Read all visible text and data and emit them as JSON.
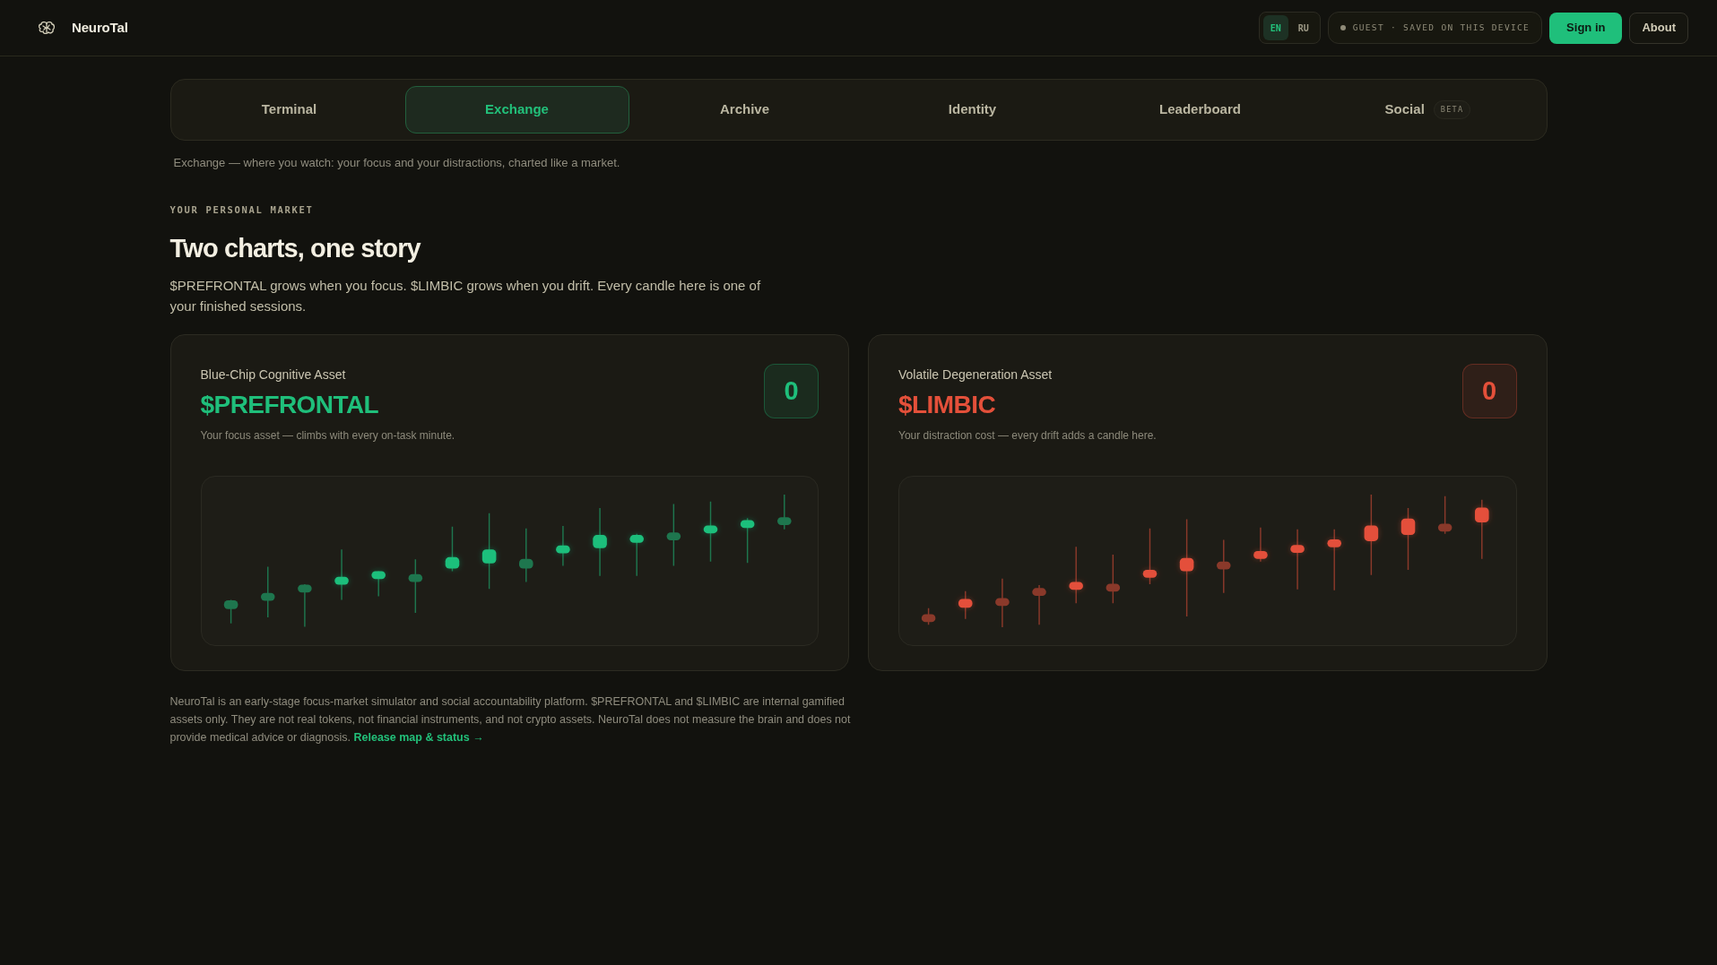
{
  "header": {
    "brand": "NeuroTal",
    "languages": [
      {
        "label": "EN",
        "selected": true
      },
      {
        "label": "RU",
        "selected": false
      }
    ],
    "status": "GUEST · SAVED ON THIS DEVICE",
    "buttons": [
      {
        "label": "Sign in",
        "kind": "primary"
      },
      {
        "label": "About",
        "kind": "secondary"
      }
    ]
  },
  "tabs": [
    {
      "label": "Terminal",
      "selected": false
    },
    {
      "label": "Exchange",
      "selected": true
    },
    {
      "label": "Archive",
      "selected": false
    },
    {
      "label": "Identity",
      "selected": false
    },
    {
      "label": "Leaderboard",
      "selected": false
    },
    {
      "label": "Social",
      "selected": false,
      "badge": "BETA"
    }
  ],
  "tab_description": "Exchange — where you watch: your focus and your distractions, charted like a market.",
  "section": {
    "eyebrow": "YOUR PERSONAL MARKET",
    "title": "Two charts, one story",
    "description": "$PREFRONTAL grows when you focus. $LIMBIC grows when you drift. Every candle here is one of your finished sessions."
  },
  "assets": [
    {
      "label": "Blue-Chip Cognitive Asset",
      "ticker": "$PREFRONTAL",
      "caption": "Your focus asset — climbs with every on-task minute.",
      "value": "0",
      "color": "#1fbf7b"
    },
    {
      "label": "Volatile Degeneration Asset",
      "ticker": "$LIMBIC",
      "caption": "Your distraction cost — every drift adds a candle here.",
      "value": "0",
      "color": "#e4503a"
    }
  ],
  "disclaimer": {
    "text": "NeuroTal is an early-stage focus-market simulator and social accountability platform. $PREFRONTAL and $LIMBIC are internal gamified assets only. They are not real tokens, not financial instruments, and not crypto assets. NeuroTal does not measure the brain and does not provide medical advice or diagnosis.",
    "link": "Release map & status →"
  }
}
